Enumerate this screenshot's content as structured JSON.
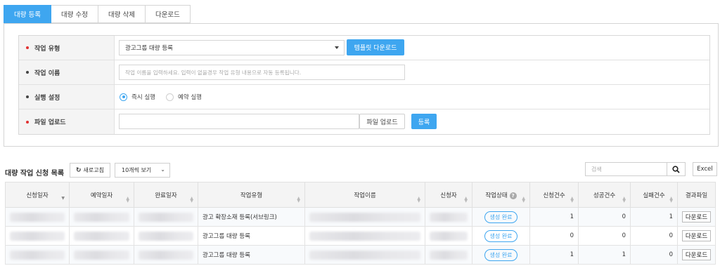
{
  "tabs": [
    {
      "label": "대량 등록",
      "active": true
    },
    {
      "label": "대량 수정",
      "active": false
    },
    {
      "label": "대량 삭제",
      "active": false
    },
    {
      "label": "다운로드",
      "active": false
    }
  ],
  "form": {
    "job_type": {
      "label": "작업 유형",
      "value": "광고그룹 대량 등록",
      "template_button": "템플릿 다운로드"
    },
    "job_name": {
      "label": "작업 이름",
      "placeholder": "작업 이름을 입력하세요. 입력이 없을경우 작업 유형 내용으로 자동 등록됩니다."
    },
    "run_setting": {
      "label": "실행 설정",
      "options": [
        {
          "label": "즉시 실행",
          "selected": true
        },
        {
          "label": "예약 실행",
          "selected": false
        }
      ]
    },
    "file_upload": {
      "label": "파일 업로드",
      "upload_button": "파일 업로드",
      "register_button": "등록"
    }
  },
  "list": {
    "title": "대량 작업 신청 목록",
    "refresh_label": "새로고침",
    "view_select": "10개씩 보기",
    "search_placeholder": "검색",
    "excel_label": "Excel"
  },
  "table": {
    "columns": [
      "신청일자",
      "예약일자",
      "완료일자",
      "작업유형",
      "작업이름",
      "신청자",
      "작업상태",
      "신청건수",
      "성공건수",
      "실패건수",
      "결과파일"
    ],
    "rows": [
      {
        "job_type": "광고 확장소재 등록(서브링크)",
        "status": "생성 완료",
        "requested": "1",
        "success": "0",
        "fail": "1",
        "result": "다운로드"
      },
      {
        "job_type": "광고그룹 대량 등록",
        "status": "생성 완료",
        "requested": "0",
        "success": "0",
        "fail": "0",
        "result": "다운로드"
      },
      {
        "job_type": "광고그룹 대량 등록",
        "status": "생성 완료",
        "requested": "1",
        "success": "1",
        "fail": "0",
        "result": "다운로드"
      }
    ]
  },
  "colors": {
    "accent": "#3ea6f0",
    "required_dot": "#e03131"
  }
}
